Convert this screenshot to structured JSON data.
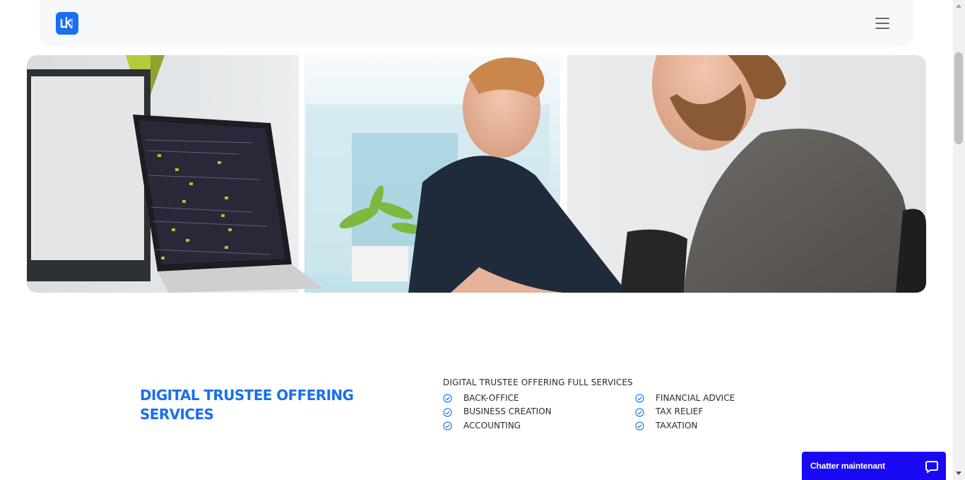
{
  "header": {
    "logo_icon": "brand-logo",
    "menu_icon": "hamburger-menu-icon"
  },
  "hero": {
    "image_description_icon": "office-photo"
  },
  "services": {
    "title": "DIGITAL TRUSTEE OFFERING SERVICES",
    "subtitle": "DIGITAL TRUSTEE OFFERING FULL SERVICES",
    "column1": [
      "BACK-OFFICE",
      "BUSINESS CREATION",
      "ACCOUNTING"
    ],
    "column2": [
      "FINANCIAL ADVICE",
      "TAX RELIEF",
      "TAXATION"
    ],
    "check_icon": "check-circle-icon"
  },
  "chat": {
    "label": "Chatter maintenant",
    "icon": "chat-bubble-icon"
  },
  "colors": {
    "accent": "#1a6ff0",
    "chat": "#1a09f5",
    "header_bg": "#f7f8fa"
  }
}
